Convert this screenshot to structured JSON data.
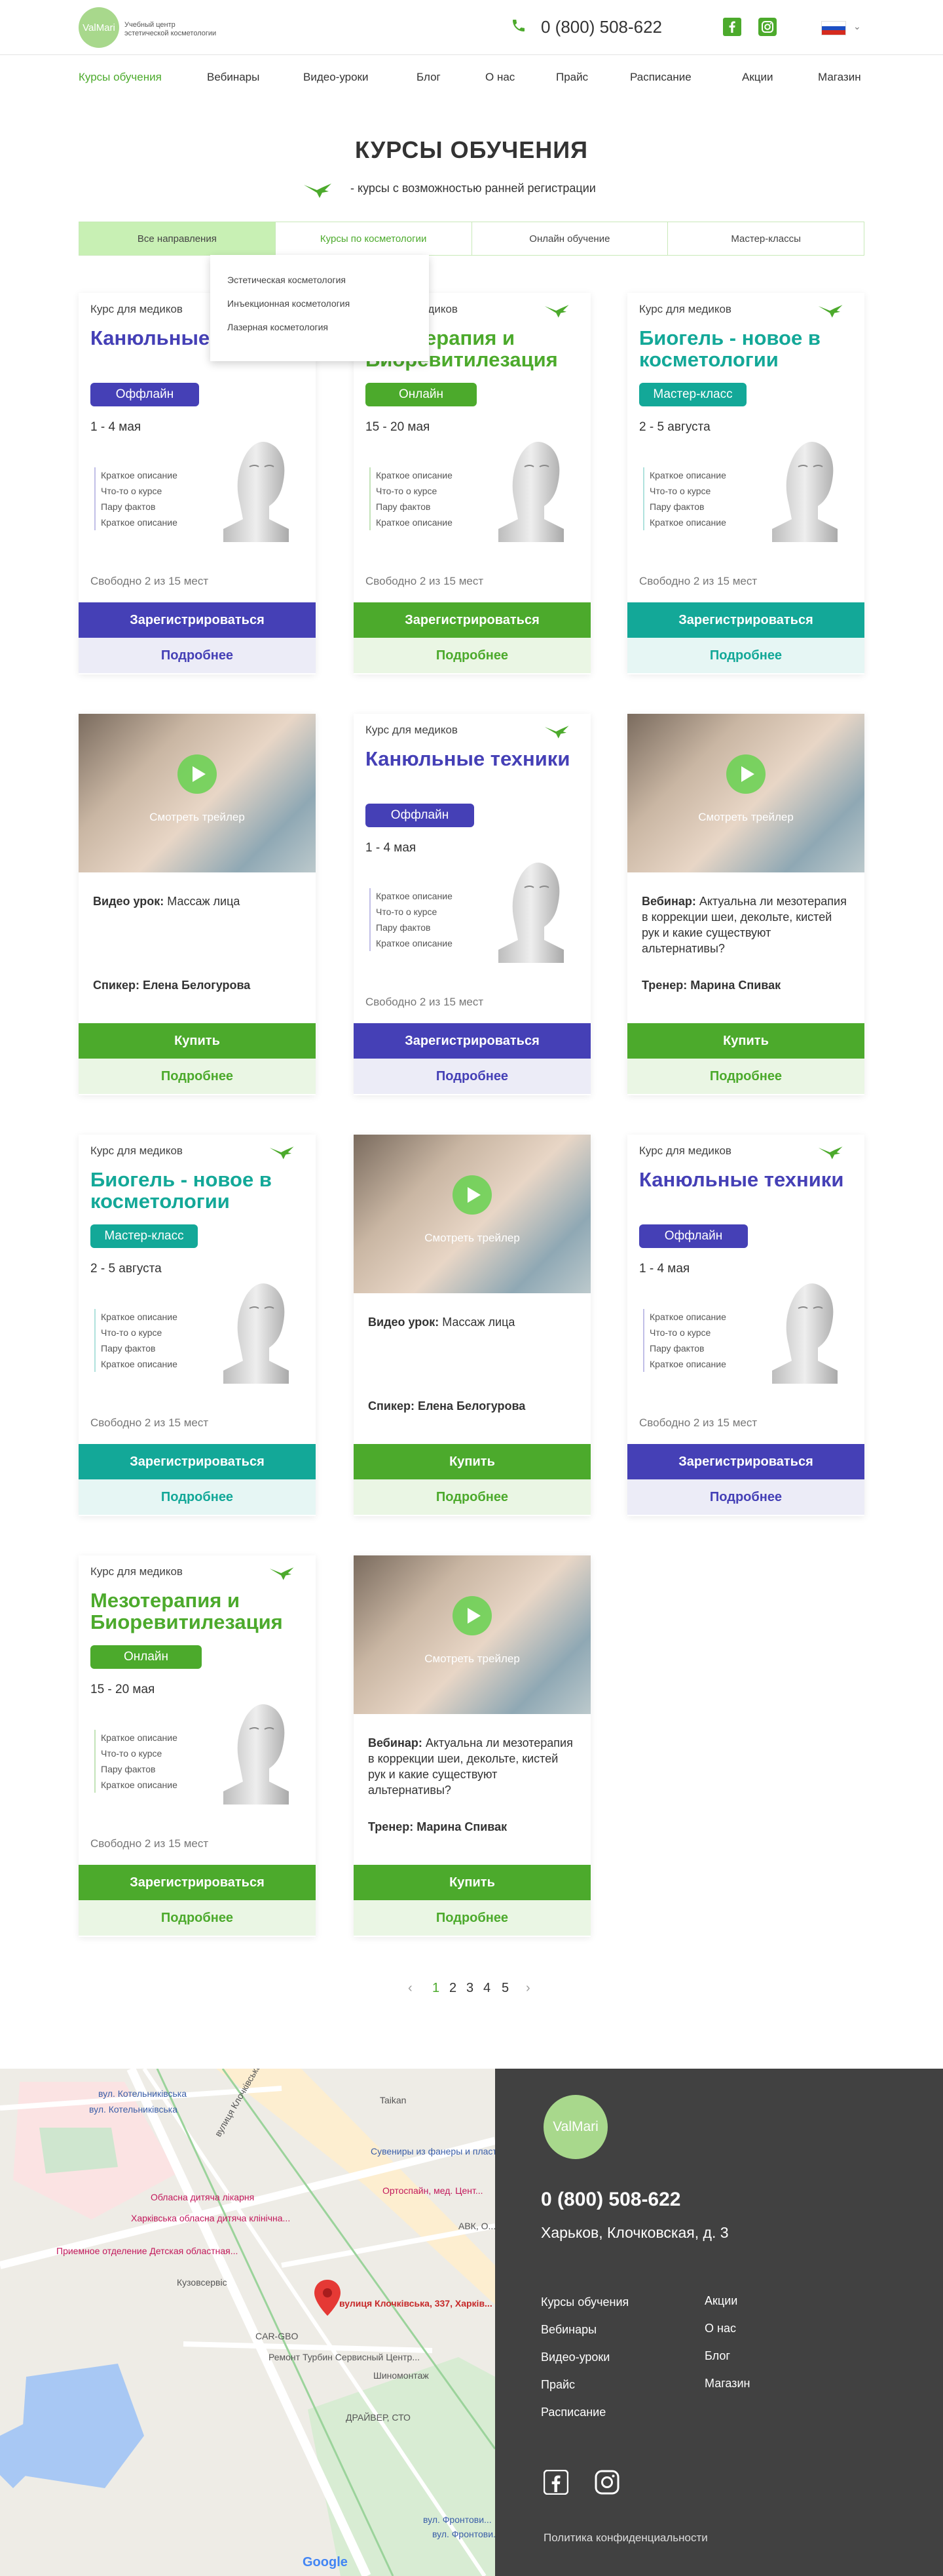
{
  "header": {
    "logo_text": "ValMari",
    "logo_caption_1": "Учебный центр",
    "logo_caption_2": "эстетической косметологии",
    "phone": "0 (800) 508-622",
    "language": "RU"
  },
  "nav": [
    "Курсы обучения",
    "Вебинары",
    "Видео-уроки",
    "Блог",
    "О нас",
    "Прайс",
    "Расписание",
    "Акции",
    "Магазин"
  ],
  "page_title": "КУРСЫ ОБУЧЕНИЯ",
  "legend_text": "- курсы с возможностью ранней регистрации",
  "filters": [
    "Все направления",
    "Курсы по косметологии",
    "Онлайн обучение",
    "Мастер-классы"
  ],
  "dropdown": [
    "Эстетическая косметология",
    "Инъекционная косметология",
    "Лазерная косметология"
  ],
  "common": {
    "tag": "Курс для медиков",
    "seats": "Свободно 2 из 15 мест",
    "register": "Зарегистрироваться",
    "more": "Подробнее",
    "buy": "Купить",
    "watch_trailer": "Смотреть трейлер",
    "bullets": [
      "Краткое описание",
      "Что-то о курсе",
      "Пару фактов",
      "Краткое описание"
    ]
  },
  "courses": {
    "kanul": {
      "title": "Канюльные техники",
      "badge": "Оффлайн",
      "dates": "1 - 4 мая"
    },
    "mezo": {
      "title": "Мезотерапия и Биоревитилезация",
      "badge": "Онлайн",
      "dates": "15 - 20 мая"
    },
    "biogel": {
      "title": "Биогель - новое в косметологии",
      "badge": "Мастер-класс",
      "dates": "2 - 5 августа"
    }
  },
  "videos": {
    "massage": {
      "label": "Видео урок:",
      "title": "Массаж лица",
      "speaker_label": "Спикер:",
      "speaker": "Елена Белогурова"
    },
    "webinar": {
      "label": "Вебинар:",
      "title": "Актуальна ли мезотерапия в коррекции шеи, декольте, кистей рук и какие существуют альтернативы?",
      "speaker_label": "Тренер:",
      "speaker": "Марина Спивак"
    }
  },
  "pagination": [
    "1",
    "2",
    "3",
    "4",
    "5"
  ],
  "footer": {
    "logo_text": "ValMari",
    "phone": "0 (800) 508-622",
    "address": "Харьков, Клочковская, д. 3",
    "links_left": [
      "Курсы обучения",
      "Вебинары",
      "Видео-уроки",
      "Прайс",
      "Расписание"
    ],
    "links_right": [
      "Акции",
      "О нас",
      "Блог",
      "Магазин"
    ],
    "privacy": "Политика конфиденциальности"
  },
  "map_labels": {
    "street1": "вул. Котельниківська",
    "street2": "вул. Котельниківська",
    "klochkivska": "вулиця Клочківська",
    "hospital": "Обласна дитяча лікарня",
    "hospital2": "Харківська обласна дитяча клінічна...",
    "reception": "Приемное отделение Детская областная...",
    "kuzo": "Кузовсервіс",
    "cargo": "CAR-GBO",
    "remont": "Ремонт Турбин Сервисный Центр...",
    "shino": "Шиномонтаж",
    "driver": "ДРАЙВЕР, СТО",
    "suvenir": "Сувениры из фанеры и пластика Wonderland",
    "orto": "Ортоспайн, мед. Цент...",
    "abk": "АВК, О...",
    "taikan": "Taikan",
    "pin": "вулиця Клочківська, 337, Харків...",
    "frontov": "вул. Фронтови...",
    "frontov2": "вул. Фронтови...",
    "google": "Google"
  },
  "colors": {
    "green": "#4caa2c",
    "blue": "#4540b6",
    "teal": "#13a898"
  }
}
